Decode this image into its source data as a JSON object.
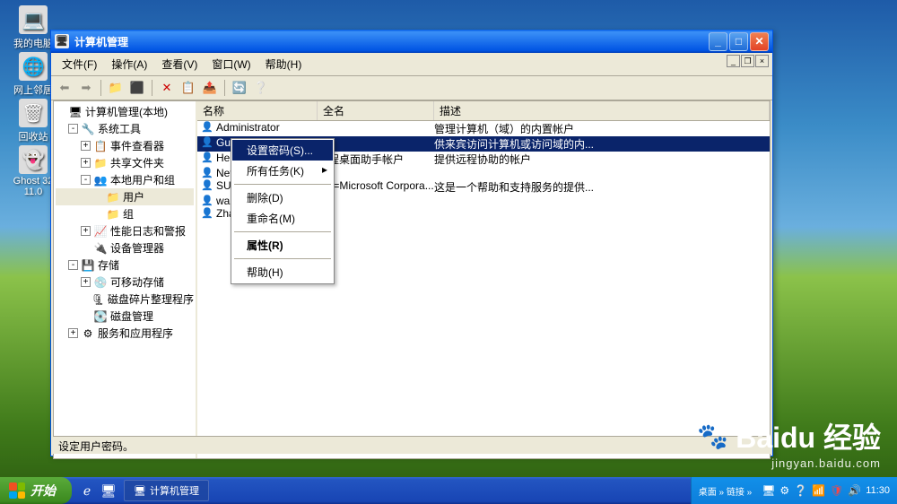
{
  "desktop": {
    "icons": [
      {
        "label": "我的电脑",
        "glyph": "💻"
      },
      {
        "label": "网上邻居",
        "glyph": "🌐"
      },
      {
        "label": "回收站",
        "glyph": "🗑"
      },
      {
        "label": "Ghost 32 11.0",
        "glyph": "👻"
      }
    ]
  },
  "window": {
    "title": "计算机管理",
    "menus": [
      {
        "label": "文件(F)"
      },
      {
        "label": "操作(A)"
      },
      {
        "label": "查看(V)"
      },
      {
        "label": "窗口(W)"
      },
      {
        "label": "帮助(H)"
      }
    ],
    "tree": [
      {
        "indent": 0,
        "exp": "none",
        "icon": "🖥",
        "label": "计算机管理(本地)"
      },
      {
        "indent": 1,
        "exp": "-",
        "icon": "🔧",
        "label": "系统工具"
      },
      {
        "indent": 2,
        "exp": "+",
        "icon": "📋",
        "label": "事件查看器"
      },
      {
        "indent": 2,
        "exp": "+",
        "icon": "📁",
        "label": "共享文件夹"
      },
      {
        "indent": 2,
        "exp": "-",
        "icon": "👥",
        "label": "本地用户和组"
      },
      {
        "indent": 3,
        "exp": "none",
        "icon": "📁",
        "label": "用户",
        "selected": true
      },
      {
        "indent": 3,
        "exp": "none",
        "icon": "📁",
        "label": "组"
      },
      {
        "indent": 2,
        "exp": "+",
        "icon": "📈",
        "label": "性能日志和警报"
      },
      {
        "indent": 2,
        "exp": "none",
        "icon": "🔌",
        "label": "设备管理器"
      },
      {
        "indent": 1,
        "exp": "-",
        "icon": "💾",
        "label": "存储"
      },
      {
        "indent": 2,
        "exp": "+",
        "icon": "💿",
        "label": "可移动存储"
      },
      {
        "indent": 2,
        "exp": "none",
        "icon": "🗜",
        "label": "磁盘碎片整理程序"
      },
      {
        "indent": 2,
        "exp": "none",
        "icon": "💽",
        "label": "磁盘管理"
      },
      {
        "indent": 1,
        "exp": "+",
        "icon": "⚙",
        "label": "服务和应用程序"
      }
    ],
    "list": {
      "headers": {
        "name": "名称",
        "full": "全名",
        "desc": "描述"
      },
      "rows": [
        {
          "name": "Administrator",
          "full": "",
          "desc": "管理计算机（域）的内置帐户"
        },
        {
          "name": "Guest",
          "full": "",
          "desc": "供来宾访问计算机或访问域的内...",
          "selected": true
        },
        {
          "name": "HelpAssistant",
          "full": "远程桌面助手帐户",
          "desc": "提供远程协助的帐户"
        },
        {
          "name": "NetworkService",
          "full": "",
          "desc": ""
        },
        {
          "name": "SUPPORT_388945a0",
          "full": "CN=Microsoft Corpora...",
          "desc": "这是一个帮助和支持服务的提供..."
        },
        {
          "name": "wangf",
          "full": "",
          "desc": ""
        },
        {
          "name": "Zhangh",
          "full": "",
          "desc": ""
        }
      ]
    },
    "status": "设定用户密码。"
  },
  "context_menu": {
    "items": [
      {
        "label": "设置密码(S)...",
        "hl": true
      },
      {
        "label": "所有任务(K)",
        "sub": true
      },
      {
        "sep": true
      },
      {
        "label": "删除(D)"
      },
      {
        "label": "重命名(M)"
      },
      {
        "sep": true
      },
      {
        "label": "属性(R)",
        "bold": true
      },
      {
        "sep": true
      },
      {
        "label": "帮助(H)"
      }
    ]
  },
  "taskbar": {
    "start": "开始",
    "task": "计算机管理",
    "tray_text": "桌面 » 链接 »",
    "clock": "11:30"
  },
  "watermark": {
    "brand": "Baidu",
    "sub": "经验",
    "url": "jingyan.baidu.com"
  }
}
